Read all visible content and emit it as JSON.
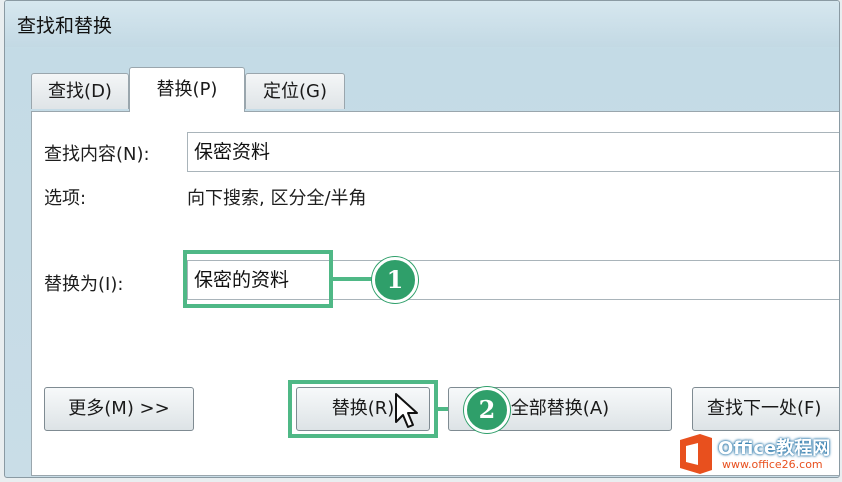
{
  "window": {
    "title": "查找和替换"
  },
  "tabs": [
    {
      "label": "查找(D)"
    },
    {
      "label": "替换(P)"
    },
    {
      "label": "定位(G)"
    }
  ],
  "find": {
    "label": "查找内容(N):",
    "value": "保密资料"
  },
  "options": {
    "label": "选项:",
    "value": "向下搜索, 区分全/半角"
  },
  "replace": {
    "label": "替换为(I):",
    "value": "保密的资料"
  },
  "buttons": {
    "more": "更多(M) >>",
    "replace": "替换(R)",
    "replace_all": "全部替换(A)",
    "find_next": "查找下一处(F)"
  },
  "callouts": [
    "1",
    "2"
  ],
  "watermark": {
    "brand": "Office教程网",
    "url": "www.office26.com"
  },
  "colors": {
    "highlight": "#4fb886",
    "callout_circle": "#2f9f6a",
    "watermark_orange": "#e8501e"
  }
}
